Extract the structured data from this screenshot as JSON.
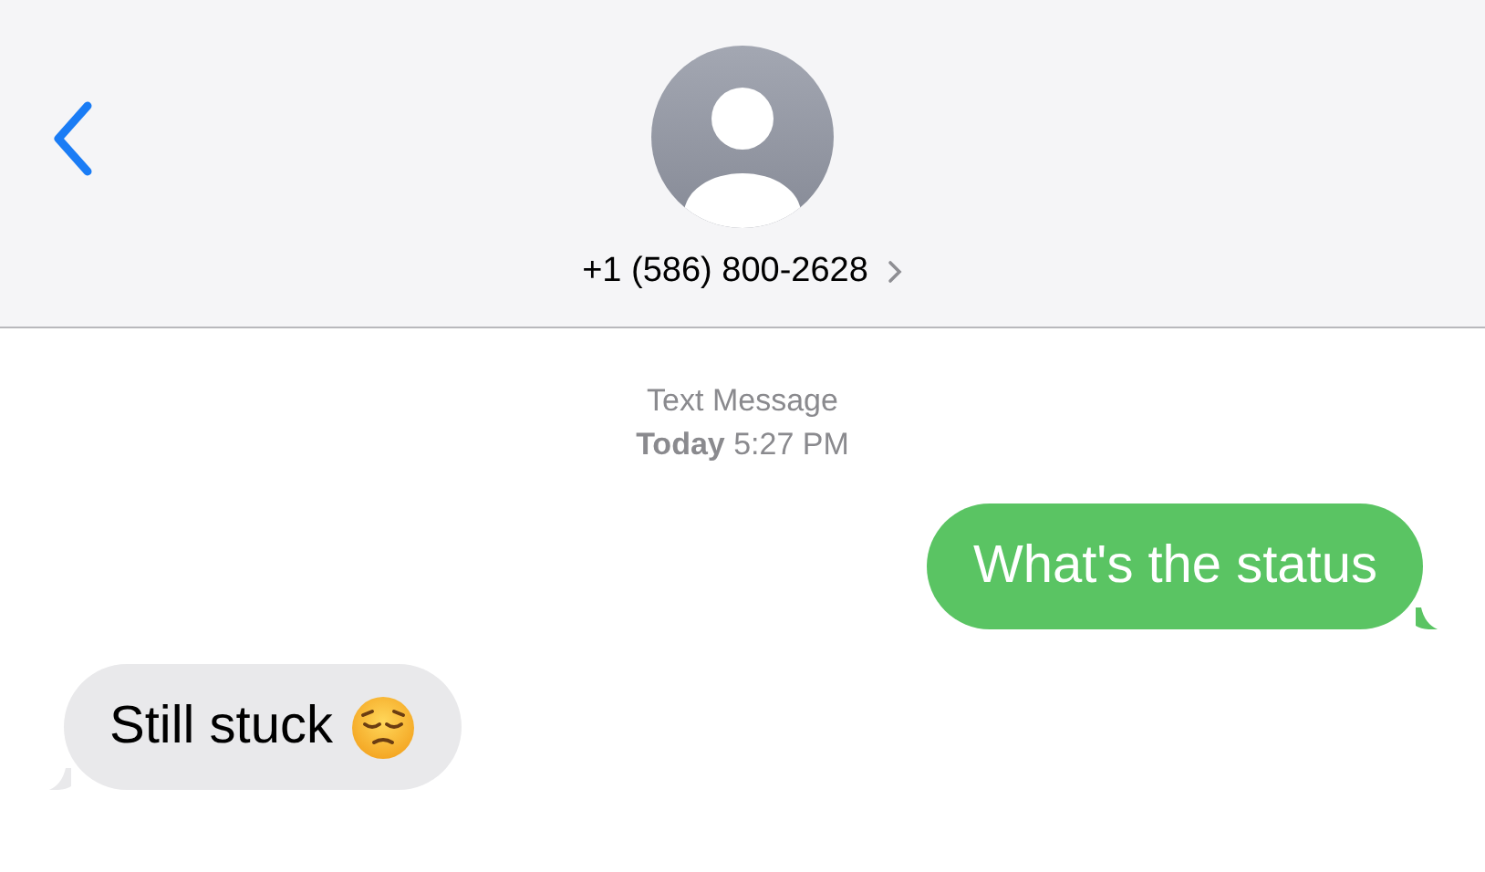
{
  "header": {
    "contact": "+1 (586) 800-2628"
  },
  "meta": {
    "service": "Text Message",
    "time": "**Today** 5:27 PM"
  },
  "messages": [
    {
      "kind": "outgoing",
      "text": "What's the status",
      "emoji": false
    },
    {
      "kind": "incoming",
      "text": "Still stuck",
      "emoji": true
    }
  ]
}
